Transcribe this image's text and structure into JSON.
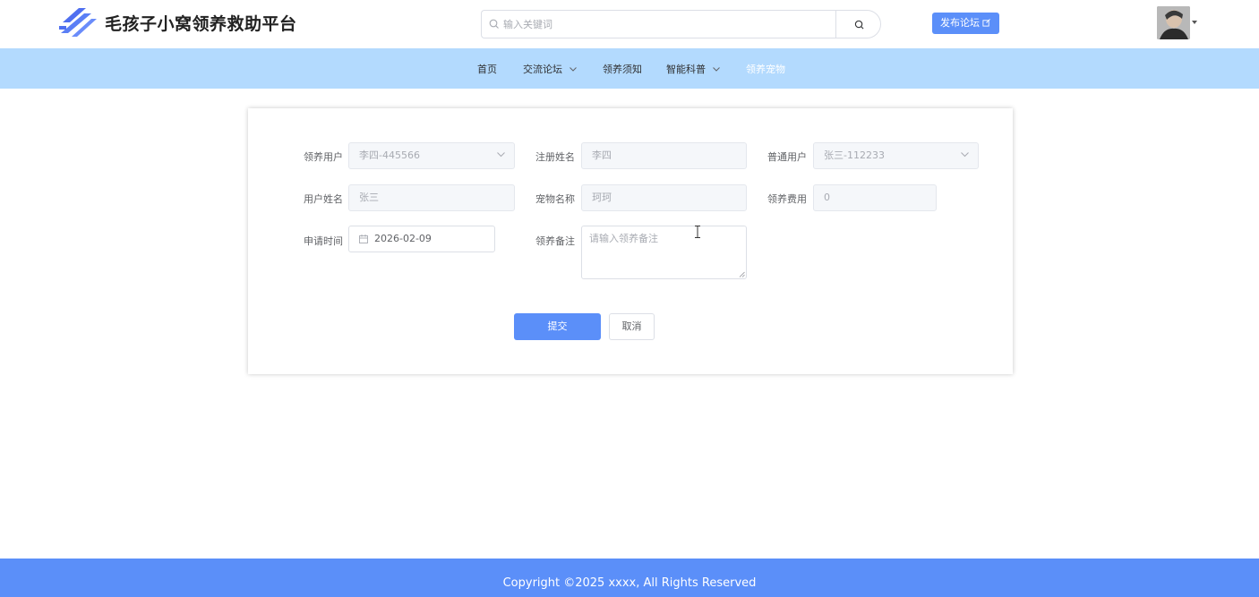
{
  "header": {
    "site_title": "毛孩子小窝领养救助平台",
    "search_placeholder": "输入关键词",
    "publish_label": "发布论坛"
  },
  "nav": {
    "items": [
      {
        "label": "首页",
        "has_dropdown": false
      },
      {
        "label": "交流论坛",
        "has_dropdown": true
      },
      {
        "label": "领养须知",
        "has_dropdown": false
      },
      {
        "label": "智能科普",
        "has_dropdown": true
      },
      {
        "label": "领养宠物",
        "has_dropdown": false,
        "active": true
      }
    ]
  },
  "form": {
    "adopt_user_label": "领养用户",
    "adopt_user_value": "李四-445566",
    "reg_name_label": "注册姓名",
    "reg_name_value": "李四",
    "normal_user_label": "普通用户",
    "normal_user_value": "张三-112233",
    "user_name_label": "用户姓名",
    "user_name_value": "张三",
    "pet_name_label": "宠物名称",
    "pet_name_value": "珂珂",
    "fee_label": "领养费用",
    "fee_value": "0",
    "apply_time_label": "申请时间",
    "apply_time_value": "2026-02-09",
    "remark_label": "领养备注",
    "remark_placeholder": "请输入领养备注",
    "submit_label": "提交",
    "cancel_label": "取消"
  },
  "footer": {
    "copyright": "Copyright ©2025 xxxx, All Rights Reserved"
  },
  "colors": {
    "primary": "#5b8ff9",
    "nav_bg": "#b3dafe",
    "footer_bg": "#5b8ff9"
  }
}
